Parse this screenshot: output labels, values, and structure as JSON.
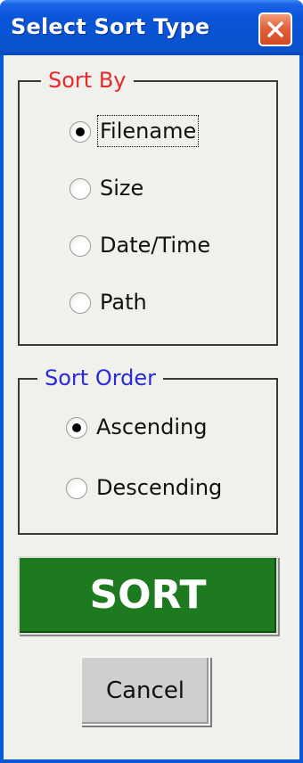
{
  "window": {
    "title": "Select Sort Type",
    "close_icon": "close-x-icon"
  },
  "sort_by": {
    "legend": "Sort By",
    "legend_color": "#e8282a",
    "selected": "Filename",
    "options": [
      {
        "label": "Filename",
        "checked": true
      },
      {
        "label": "Size",
        "checked": false
      },
      {
        "label": "Date/Time",
        "checked": false
      },
      {
        "label": "Path",
        "checked": false
      }
    ]
  },
  "sort_order": {
    "legend": "Sort Order",
    "legend_color": "#2a2ad8",
    "selected": "Ascending",
    "options": [
      {
        "label": "Ascending",
        "checked": true
      },
      {
        "label": "Descending",
        "checked": false
      }
    ]
  },
  "buttons": {
    "sort_label": "SORT",
    "sort_color": "#1e7a1e",
    "cancel_label": "Cancel"
  }
}
